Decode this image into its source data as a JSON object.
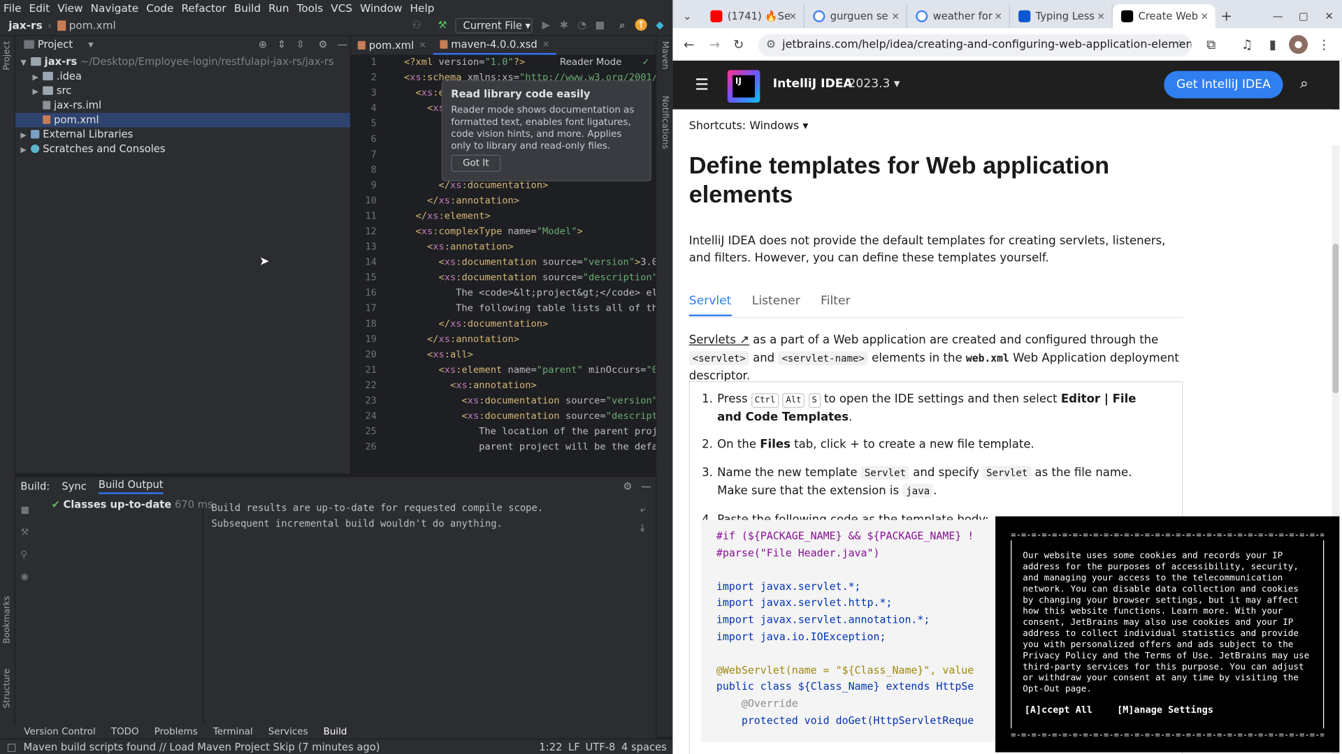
{
  "ide": {
    "menu": [
      "File",
      "Edit",
      "View",
      "Navigate",
      "Code",
      "Refactor",
      "Build",
      "Run",
      "Tools",
      "VCS",
      "Window",
      "Help"
    ],
    "breadcrumb": {
      "project": "jax-rs",
      "file": "pom.xml"
    },
    "run_config": "Current File",
    "project_panel": {
      "title": "Project",
      "root": "jax-rs",
      "root_path": "~/Desktop/Employee-login/restfulapi-jax-rs/jax-rs",
      "items": [
        ".idea",
        "src",
        "jax-rs.iml",
        "pom.xml"
      ],
      "external": "External Libraries",
      "scratches": "Scratches and Consoles"
    },
    "editor_tabs": [
      "pom.xml",
      "maven-4.0.0.xsd"
    ],
    "reader_mode_label": "Reader Mode",
    "tooltip": {
      "title": "Read library code easily",
      "body": "Reader mode shows documentation as formatted text, enables font ligatures, code vision hints, and more. Applies only to library and read-only files.",
      "button": "Got It"
    },
    "line_numbers": [
      "1",
      "2",
      "3",
      "4",
      "5",
      "6",
      "7",
      "8",
      "9",
      "10",
      "11",
      "12",
      "13",
      "14",
      "15",
      "16",
      "17",
      "18",
      "19",
      "20",
      "21",
      "22",
      "23",
      "24",
      "25",
      "26"
    ],
    "build": {
      "tabs": [
        "Build:",
        "Sync",
        "Build Output"
      ],
      "tree_item": "Classes up-to-date",
      "tree_time": "670 ms",
      "output_lines": [
        "Build results are up-to-date for requested compile scope.",
        "Subsequent incremental build wouldn't do anything."
      ]
    },
    "tool_windows": [
      "Version Control",
      "TODO",
      "Problems",
      "Terminal",
      "Services",
      "Build"
    ],
    "side_labels": {
      "project": "Project",
      "bookmarks": "Bookmarks",
      "structure": "Structure",
      "maven": "Maven",
      "notifications": "Notifications"
    },
    "status": {
      "message": "Maven build scripts found // Load Maven Project   Skip (7 minutes ago)",
      "position": "1:22",
      "line_sep": "LF",
      "encoding": "UTF-8",
      "indent": "4 spaces"
    }
  },
  "browser": {
    "tabs": [
      {
        "title": "(1741) 🔥Se",
        "color": "#ff0000"
      },
      {
        "title": "gurguen se",
        "color": "#4285f4"
      },
      {
        "title": "weather for",
        "color": "#4285f4"
      },
      {
        "title": "Typing Less",
        "color": "#0b57d0"
      },
      {
        "title": "Create Web",
        "color": "#000000"
      }
    ],
    "url": "jetbrains.com/help/idea/creating-and-configuring-web-application-element...",
    "site": {
      "product": "IntelliJ IDEA",
      "version": "2023.3",
      "logo_text": "IJ",
      "cta": "Get IntelliJ IDEA"
    },
    "shortcuts": "Shortcuts: Windows",
    "heading": "Define templates for Web application elements",
    "intro": "IntelliJ IDEA does not provide the default templates for creating servlets, listeners, and filters. However, you can define these templates yourself.",
    "doc_tabs": [
      "Servlet",
      "Listener",
      "Filter"
    ],
    "para": {
      "a": "Servlets ↗",
      "b": " as a part of a Web application are created and configured through the ",
      "code1": "<servlet>",
      "c": " and ",
      "code2": "<servlet-name>",
      "d": " elements in the ",
      "bold": "web.xml",
      "e": " Web Application deployment descriptor."
    },
    "steps": {
      "s1": {
        "n": "1.",
        "pre": "Press ",
        "k1": "Ctrl",
        "k2": "Alt",
        "k3": "S",
        "mid": " to open the IDE settings and then select ",
        "bold": "Editor | File and Code Templates",
        "end": "."
      },
      "s2": {
        "n": "2.",
        "pre": "On the ",
        "bold": "Files",
        "post": " tab, click + to create a new file template."
      },
      "s3": {
        "n": "3.",
        "pre": "Name the new template ",
        "c1": "Servlet",
        "mid": " and specify ",
        "c2": "Servlet",
        "post": " as the file name. Make sure that the extension is ",
        "c3": "java",
        "end": "."
      },
      "s4": {
        "n": "4.",
        "text": "Paste the following code as the template body:"
      }
    },
    "code": {
      "l1": "#if (${PACKAGE_NAME} && ${PACKAGE_NAME} !",
      "l2": "#parse(\"File Header.java\")",
      "l3": "import javax.servlet.*;",
      "l4": "import javax.servlet.http.*;",
      "l5": "import javax.servlet.annotation.*;",
      "l6": "import java.io.IOException;",
      "l7": "@WebServlet(name = \"${Class_Name}\", value",
      "l8": "public class ${Class_Name} extends HttpSe",
      "l9": "    @Override",
      "l10": "    protected void doGet(HttpServletReque"
    },
    "cookie": {
      "text": "Our website uses some cookies and records your IP address for the purposes of accessibility, security, and managing your access to the telecommunication network. You can disable data collection and cookies by changing your browser settings, but it may affect how this website functions. Learn more. With your consent, JetBrains may also use cookies and your IP address to collect individual statistics and provide you with personalized offers and ads subject to the Privacy Policy and the Terms of Use. JetBrains may use third-party services for this purpose. You can adjust or withdraw your consent at any time by visiting the Opt-Out page.",
      "accept": "[A]ccept All",
      "manage": "[M]anage Settings"
    }
  }
}
